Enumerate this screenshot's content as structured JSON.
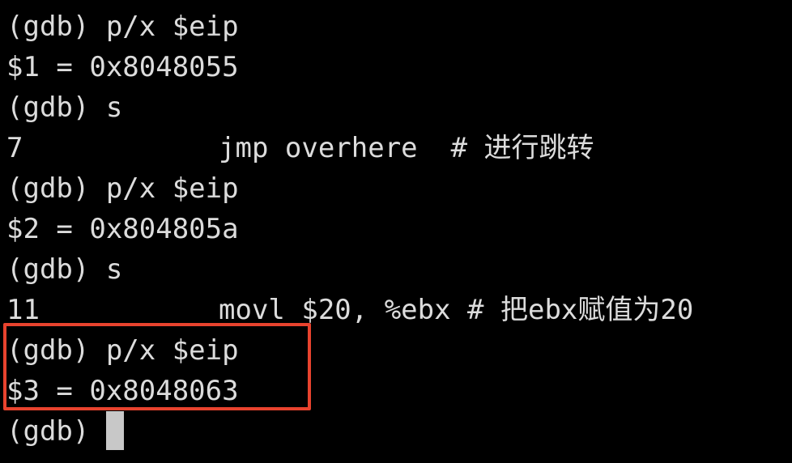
{
  "terminal": {
    "lines": [
      {
        "text": "(gdb) p/x $eip"
      },
      {
        "text": "$1 = 0x8048055"
      },
      {
        "text": "(gdb) s"
      },
      {
        "num": "7",
        "code": "jmp overhere  # 进行跳转"
      },
      {
        "text": "(gdb) p/x $eip"
      },
      {
        "text": "$2 = 0x804805a"
      },
      {
        "text": "(gdb) s"
      },
      {
        "num": "11",
        "code": "movl $20, %ebx # 把ebx赋值为20"
      },
      {
        "text": "(gdb) p/x $eip"
      },
      {
        "text": "$3 = 0x8048063"
      },
      {
        "prompt": "(gdb) "
      }
    ]
  },
  "colors": {
    "background": "#000000",
    "text": "#dcdcdc",
    "cursor": "#c8c8c8",
    "highlight_box": "#e8432e"
  }
}
